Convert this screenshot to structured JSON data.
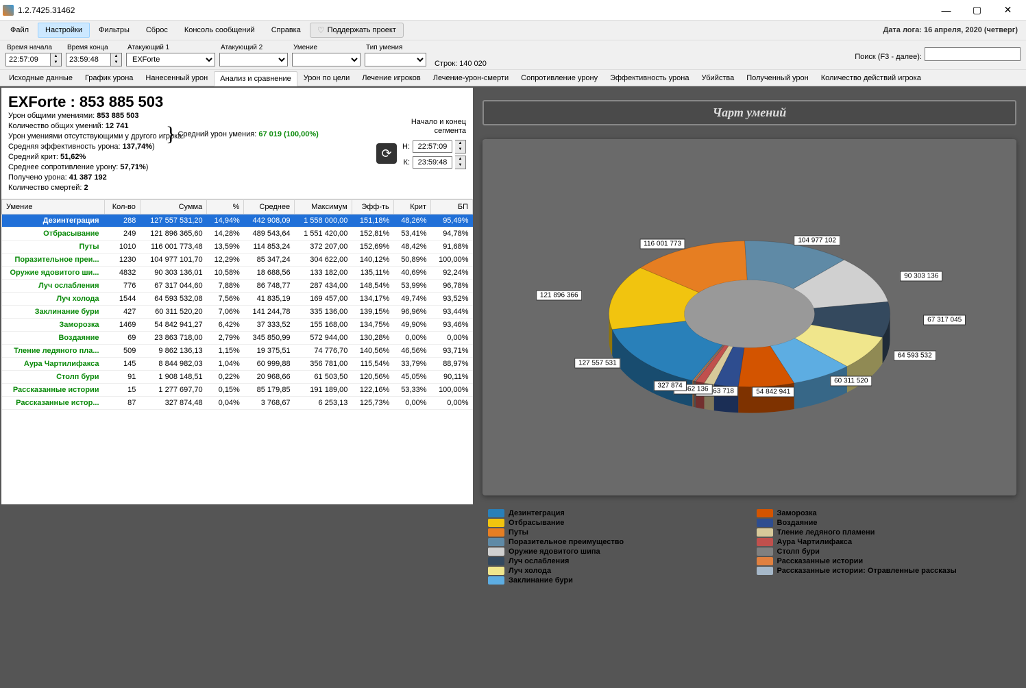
{
  "titlebar": {
    "version": "1.2.7425.31462"
  },
  "menu": {
    "items": [
      "Файл",
      "Настройки",
      "Фильтры",
      "Сброс",
      "Консоль сообщений",
      "Справка"
    ],
    "selected": 1,
    "support": "Поддержать проект",
    "logdate": "Дата лога: 16 апреля, 2020  (четверг)"
  },
  "filters": {
    "start_label": "Время начала",
    "start": "22:57:09",
    "end_label": "Время конца",
    "end": "23:59:48",
    "atk1_label": "Атакующий 1",
    "atk1": "EXForte",
    "atk2_label": "Атакующий 2",
    "atk2": "",
    "skill_label": "Умение",
    "skill": "",
    "typ_label": "Тип умения",
    "typ": "",
    "rows": "Строк: 140 020",
    "search_label": "Поиск (F3 - далее):",
    "search": ""
  },
  "tabs": {
    "list": [
      "Исходные данные",
      "График урона",
      "Нанесенный урон",
      "Анализ и сравнение",
      "Урон по цели",
      "Лечение игроков",
      "Лечение-урон-смерти",
      "Сопротивление урону",
      "Эффективность урона",
      "Убийства",
      "Полученный урон",
      "Количество действий игрока"
    ],
    "active": 3
  },
  "summary": {
    "name": "EXForte : ",
    "total": "853 885 503",
    "l1a": "Урон общими умениями: ",
    "l1b": "853 885 503",
    "l2a": "Количество общих умений: ",
    "l2b": "12 741",
    "l3": "Урон умениями отсутствующими у другого игрока:",
    "l4a": "Средняя эффективность урона: ",
    "l4b": "137,74%",
    "l5a": "Средний крит: ",
    "l5b": "51,62%",
    "l6a": "Среднее сопротивление урону: ",
    "l6b": "57,71%",
    "l7a": "Получено урона: ",
    "l7b": "41 387 192",
    "l8a": "Количество смертей: ",
    "l8b": "2",
    "avg_label": "Средний урон умения: ",
    "avg_val": "67 019 (100,00%)",
    "seg_label1": "Начало и конец",
    "seg_label2": "сегмента",
    "seg_n": "Н:",
    "seg_n_val": "22:57:09",
    "seg_k": "К:",
    "seg_k_val": "23:59:48"
  },
  "table": {
    "headers": [
      "Умение",
      "Кол-во",
      "Сумма",
      "%",
      "Среднее",
      "Максимум",
      "Эфф-ть",
      "Крит",
      "БП"
    ],
    "rows": [
      [
        "Дезинтеграция",
        "288",
        "127 557 531,20",
        "14,94%",
        "442 908,09",
        "1 558 000,00",
        "151,18%",
        "48,26%",
        "95,49%"
      ],
      [
        "Отбрасывание",
        "249",
        "121 896 365,60",
        "14,28%",
        "489 543,64",
        "1 551 420,00",
        "152,81%",
        "53,41%",
        "94,78%"
      ],
      [
        "Путы",
        "1010",
        "116 001 773,48",
        "13,59%",
        "114 853,24",
        "372 207,00",
        "152,69%",
        "48,42%",
        "91,68%"
      ],
      [
        "Поразительное преи...",
        "1230",
        "104 977 101,70",
        "12,29%",
        "85 347,24",
        "304 622,00",
        "140,12%",
        "50,89%",
        "100,00%"
      ],
      [
        "Оружие ядовитого ши...",
        "4832",
        "90 303 136,01",
        "10,58%",
        "18 688,56",
        "133 182,00",
        "135,11%",
        "40,69%",
        "92,24%"
      ],
      [
        "Луч ослабления",
        "776",
        "67 317 044,60",
        "7,88%",
        "86 748,77",
        "287 434,00",
        "148,54%",
        "53,99%",
        "96,78%"
      ],
      [
        "Луч холода",
        "1544",
        "64 593 532,08",
        "7,56%",
        "41 835,19",
        "169 457,00",
        "134,17%",
        "49,74%",
        "93,52%"
      ],
      [
        "Заклинание бури",
        "427",
        "60 311 520,20",
        "7,06%",
        "141 244,78",
        "335 136,00",
        "139,15%",
        "96,96%",
        "93,44%"
      ],
      [
        "Заморозка",
        "1469",
        "54 842 941,27",
        "6,42%",
        "37 333,52",
        "155 168,00",
        "134,75%",
        "49,90%",
        "93,46%"
      ],
      [
        "Воздаяние",
        "69",
        "23 863 718,00",
        "2,79%",
        "345 850,99",
        "572 944,00",
        "130,28%",
        "0,00%",
        "0,00%"
      ],
      [
        "Тление ледяного пла...",
        "509",
        "9 862 136,13",
        "1,15%",
        "19 375,51",
        "74 776,70",
        "140,56%",
        "46,56%",
        "93,71%"
      ],
      [
        "Аура Чартилифакса",
        "145",
        "8 844 982,03",
        "1,04%",
        "60 999,88",
        "356 781,00",
        "115,54%",
        "33,79%",
        "88,97%"
      ],
      [
        "Столп бури",
        "91",
        "1 908 148,51",
        "0,22%",
        "20 968,66",
        "61 503,50",
        "120,56%",
        "45,05%",
        "90,11%"
      ],
      [
        "Рассказанные истории",
        "15",
        "1 277 697,70",
        "0,15%",
        "85 179,85",
        "191 189,00",
        "122,16%",
        "53,33%",
        "100,00%"
      ],
      [
        "Рассказанные истор...",
        "87",
        "327 874,48",
        "0,04%",
        "3 768,67",
        "6 253,13",
        "125,73%",
        "0,00%",
        "0,00%"
      ]
    ]
  },
  "chart_title": "Чарт умений",
  "chart_data": {
    "type": "pie",
    "title": "Чарт умений",
    "series": [
      {
        "name": "Дезинтеграция",
        "value": 127557531,
        "label": "127 557 531",
        "color": "#2980b9"
      },
      {
        "name": "Отбрасывание",
        "value": 121896366,
        "label": "121 896 366",
        "color": "#f1c40f"
      },
      {
        "name": "Путы",
        "value": 116001773,
        "label": "116 001 773",
        "color": "#e67e22"
      },
      {
        "name": "Поразительное преимущество",
        "value": 104977102,
        "label": "104 977 102",
        "color": "#5f8aa6"
      },
      {
        "name": "Оружие ядовитого шипа",
        "value": 90303136,
        "label": "90 303 136",
        "color": "#d0d0d0"
      },
      {
        "name": "Луч ослабления",
        "value": 67317045,
        "label": "67 317 045",
        "color": "#34495e"
      },
      {
        "name": "Луч холода",
        "value": 64593532,
        "label": "64 593 532",
        "color": "#f0e68c"
      },
      {
        "name": "Заклинание бури",
        "value": 60311520,
        "label": "60 311 520",
        "color": "#5dade2"
      },
      {
        "name": "Заморозка",
        "value": 54842941,
        "label": "54 842 941",
        "color": "#d35400"
      },
      {
        "name": "Воздаяние",
        "value": 23863718,
        "label": "23 863 718",
        "color": "#2e4d8f"
      },
      {
        "name": "Тление ледяного пламени",
        "value": 9862136,
        "label": "9 862 136",
        "color": "#d7c99a"
      },
      {
        "name": "Аура Чартилифакса",
        "value": 8844982,
        "label": "",
        "color": "#c0504d"
      },
      {
        "name": "Столп бури",
        "value": 1908149,
        "label": "",
        "color": "#808080"
      },
      {
        "name": "Рассказанные истории",
        "value": 1277698,
        "label": "",
        "color": "#e08040"
      },
      {
        "name": "Рассказанные истории: Отравленные рассказы",
        "value": 327874,
        "label": "327 874",
        "color": "#a6b8c9"
      }
    ]
  },
  "legend_cols": [
    [
      "Дезинтеграция",
      "Отбрасывание",
      "Путы",
      "Поразительное преимущество",
      "Оружие ядовитого шипа",
      "Луч ослабления",
      "Луч холода",
      "Заклинание бури"
    ],
    [
      "Заморозка",
      "Воздаяние",
      "Тление ледяного пламени",
      "Аура Чартилифакса",
      "Столп бури",
      "Рассказанные истории",
      "Рассказанные истории: Отравленные рассказы"
    ]
  ],
  "legend_colors": [
    "#2980b9",
    "#f1c40f",
    "#e67e22",
    "#5f8aa6",
    "#d0d0d0",
    "#34495e",
    "#f0e68c",
    "#5dade2",
    "#d35400",
    "#2e4d8f",
    "#d7c99a",
    "#c0504d",
    "#808080",
    "#e08040",
    "#a6b8c9"
  ]
}
